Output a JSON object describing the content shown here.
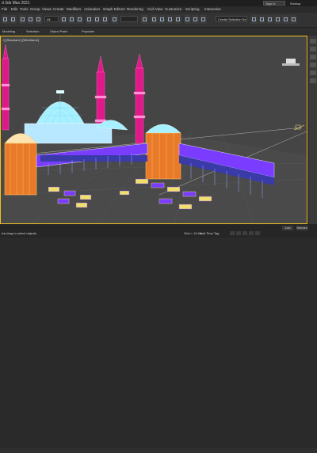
{
  "titlebar": {
    "app_title": "d 3ds Max 2021",
    "signin": "Sign In",
    "workspace": "Worksp"
  },
  "menubar": {
    "items": [
      "File",
      "Edit",
      "Tools",
      "Group",
      "Views",
      "Create",
      "Modifiers",
      "Animation",
      "Graph Editors",
      "Rendering",
      "Civil View",
      "Customize",
      "Scripting",
      "Interactive"
    ]
  },
  "toolbar": {
    "selection_filter": "All",
    "named_set": "Create Selection Se"
  },
  "ribbon": {
    "items": [
      "Modeling",
      "Selection",
      "Object Paint",
      "Populate"
    ]
  },
  "viewport": {
    "label": "+] [Standard ] [Wireframe]"
  },
  "statusbar": {
    "message": "ick-drag to select objects",
    "grid": "Grid = 10,0m",
    "time_tag": "Add Time Tag",
    "selected_label": "Selected",
    "selected_value": "Auto"
  },
  "colors": {
    "active_border": "#f0c020",
    "minaret": "#e0188a",
    "dome": "#a8f0ff",
    "roof": "#7a3cff"
  }
}
